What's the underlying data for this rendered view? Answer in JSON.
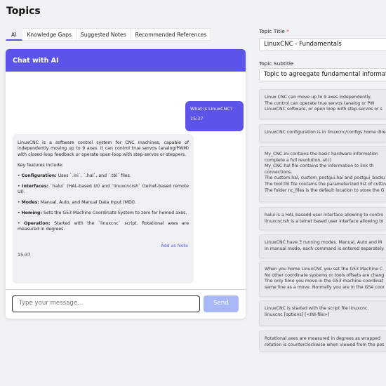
{
  "page": {
    "title": "Topics"
  },
  "tabs": [
    {
      "label": "AI",
      "active": true
    },
    {
      "label": "Knowledge Gaps",
      "active": false
    },
    {
      "label": "Suggested Notes",
      "active": false
    },
    {
      "label": "Recommended References",
      "active": false
    }
  ],
  "chat": {
    "title": "Chat with AI",
    "user_message": {
      "text": "What is LinuxCNC?",
      "time": "15:37"
    },
    "ai_message": {
      "intro": "LinuxCNC is a software control system for CNC machines, capable of independently moving up to 9 axes. It can control true servos (analog/PWM) with closed-loop feedback or operate open-loop with step-servos or steppers.",
      "features_heading": "Key features include:",
      "features": [
        {
          "label": "Configuration:",
          "text": "Uses `.ini`, `.hal`, and `.tbl` files."
        },
        {
          "label": "Interfaces:",
          "text": "`halui` (HAL-based UI) and `linuxcncrsh` (telnet-based remote UI)."
        },
        {
          "label": "Modes:",
          "text": "Manual, Auto, and Manual Data Input (MDI)."
        },
        {
          "label": "Homing:",
          "text": "Sets the G53 Machine Coordinate System to zero for homed axes."
        },
        {
          "label": "Operation:",
          "text": "Started with the `linuxcnc` script. Rotational axes are measured in degrees."
        }
      ],
      "add_note": "Add as Note",
      "time": "15:37"
    },
    "input_placeholder": "Type your message...",
    "send_label": "Send"
  },
  "form": {
    "title_label": "Topic Title",
    "title_required": "*",
    "title_value": "LinuxCNC - Fundamentals",
    "subtitle_label": "Topic Subtitle",
    "subtitle_value": "Topic to agreegate fundamental informati"
  },
  "notes": [
    {
      "lines": [
        "Linux CNC can move up to 9 axes independently.",
        "The control can operate true servos (analog or PW",
        "LinuxCNC software, or open loop with step-servos or s"
      ]
    },
    {
      "lines": [
        "LinuxCNC configuration is in linuxcnc/configs home dire"
      ]
    },
    {
      "lines": [
        "My_CNC.ini contains the basic hardware information",
        "complete a full revolution, etc)",
        "My_CNC.hal file contains the information to link th",
        "connections.",
        "The custom.hal, custom_postgui.hal and postgui_backu",
        "The tool.tbl file contains the parameterized list of cuttin",
        "The folder nc_files is the default location to store the G"
      ]
    },
    {
      "lines": [
        "halui is a HAL basedd user interface allowing to contro",
        "linuxcncrsh is a telnet based user interface allowing to"
      ]
    },
    {
      "lines": [
        "LinuxCNC have 3 running modes. Manual, Auto and M",
        "In manual mode, each command is entered separately."
      ]
    },
    {
      "lines": [
        "When you home LinuxCNC you set the G53 Machine C",
        "No other coordinate systems or tools offsets are chang",
        "The only time you move in the G53 machine coordinat",
        "same line as a move. Normally you are in the G54 coor"
      ]
    },
    {
      "lines": [
        "LinuxCNC is started with the script file linuxcnc.",
        "linuxcnc [options] [<INI-file>]"
      ]
    },
    {
      "lines": [
        "Rotational axes are measured in degrees as wrapped",
        "rotation is counterclockwise when viewed from the pos"
      ]
    }
  ]
}
